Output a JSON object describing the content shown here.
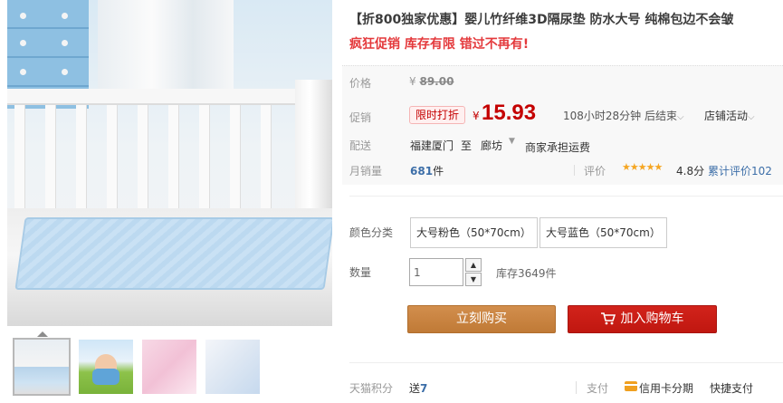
{
  "product": {
    "title": "【折800独家优惠】婴儿竹纤维3D隔尿垫 防水大号 纯棉包边不会皱",
    "subtitle": "疯狂促销 库存有限 错过不再有!"
  },
  "price": {
    "label": "价格",
    "original_currency": "¥",
    "original": "89.00",
    "promo_label": "促销",
    "promo_tag": "限时打折",
    "currency": "¥",
    "current": "15.93",
    "countdown": "108小时28分钟 后结束",
    "store_activity": "店铺活动"
  },
  "shipping": {
    "label": "配送",
    "from": "福建厦门",
    "to_label": "至",
    "to": "廊坊",
    "note": "商家承担运费"
  },
  "sales": {
    "label": "月销量",
    "count": "681",
    "unit": "件",
    "rating_label": "评价",
    "stars": "★★★★★",
    "score": "4.8分",
    "reviews": "累计评价102"
  },
  "sku": {
    "label": "颜色分类",
    "options": [
      "大号粉色（50*70cm）",
      "大号蓝色（50*70cm）"
    ]
  },
  "quantity": {
    "label": "数量",
    "value": "1",
    "stock": "库存3649件"
  },
  "actions": {
    "buy_now": "立刻购买",
    "add_to_cart": "加入购物车"
  },
  "footer": {
    "points_label": "天猫积分",
    "points_prefix": "送",
    "points_value": "7",
    "pay_label": "支付",
    "credit_card": "信用卡分期",
    "quick_pay": "快捷支付"
  },
  "colors": {
    "price_red": "#c40000",
    "buy_btn": "#c9843f",
    "cart_btn": "#c8201a",
    "link_blue": "#3c6ea8"
  }
}
